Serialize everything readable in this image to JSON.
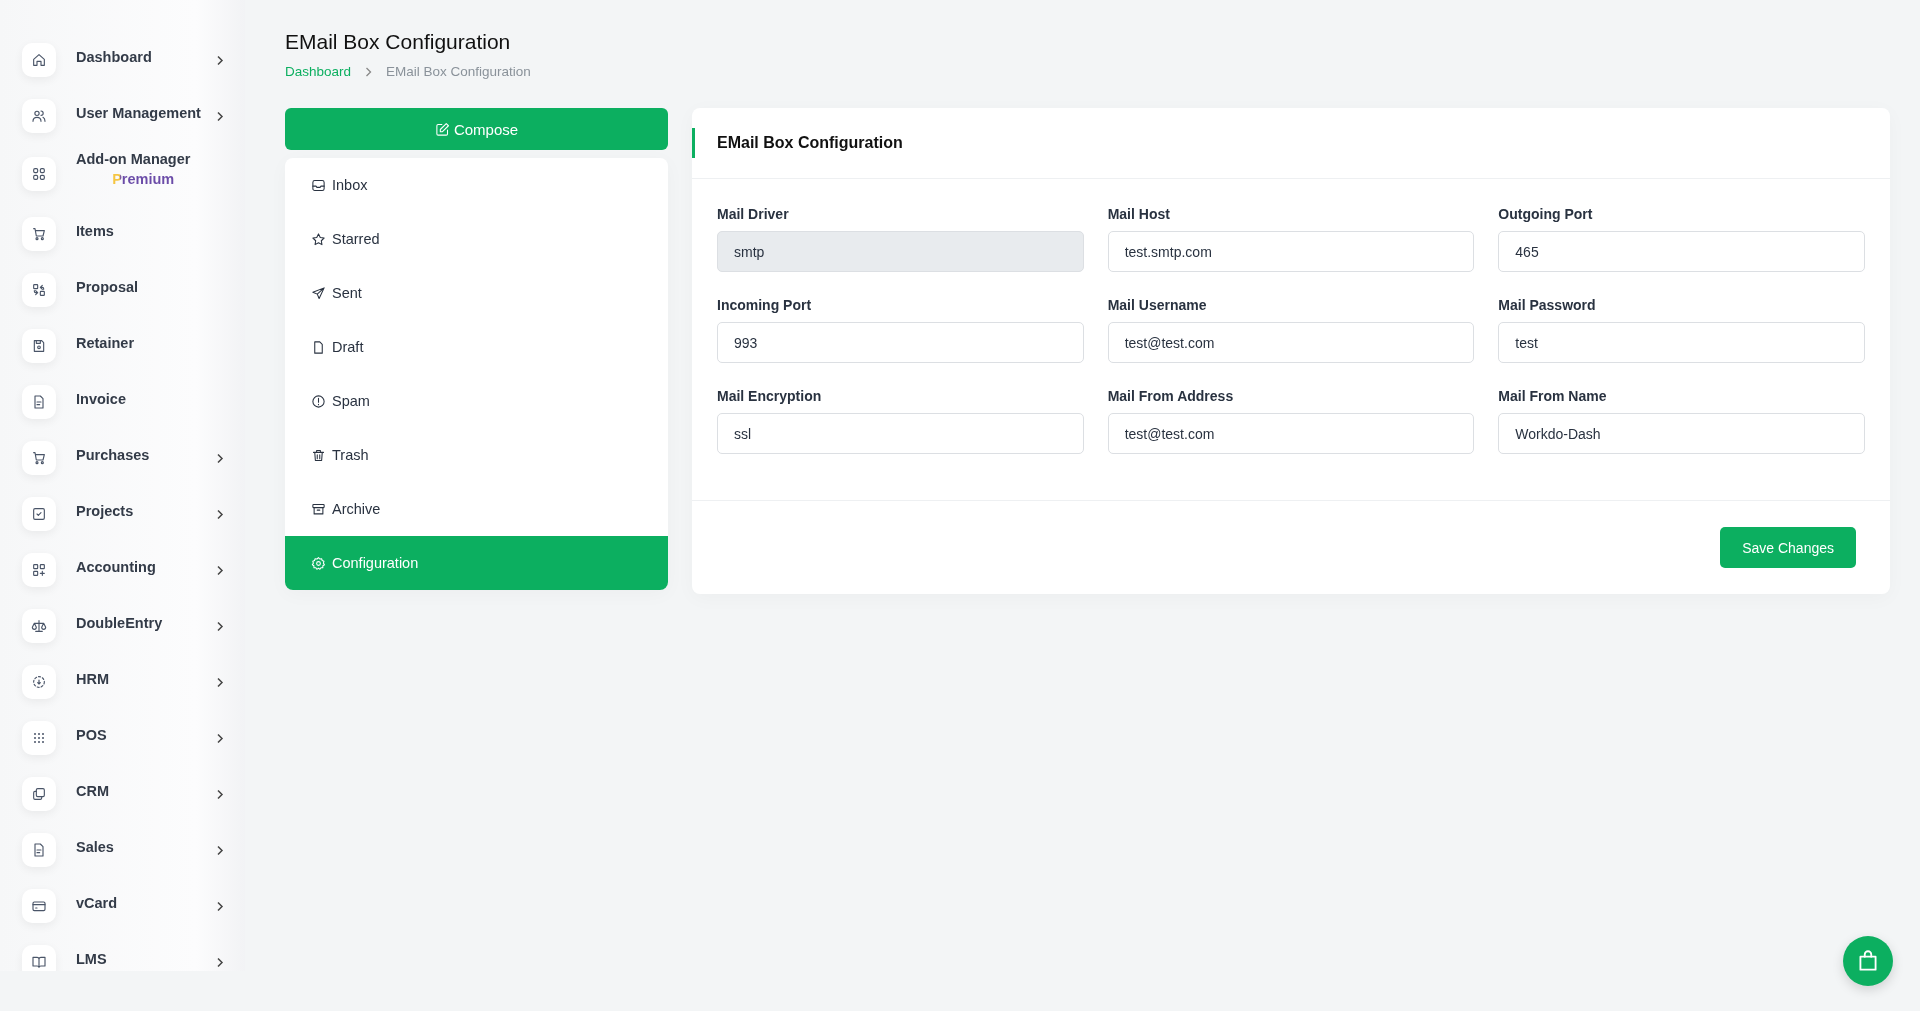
{
  "sidebar": {
    "items": [
      {
        "label": "Dashboard",
        "expandable": true
      },
      {
        "label": "User Management",
        "expandable": true
      },
      {
        "label": "Add-on Manager",
        "badge": "Premium",
        "expandable": false
      },
      {
        "label": "Items",
        "expandable": false
      },
      {
        "label": "Proposal",
        "expandable": false
      },
      {
        "label": "Retainer",
        "expandable": false
      },
      {
        "label": "Invoice",
        "expandable": false
      },
      {
        "label": "Purchases",
        "expandable": true
      },
      {
        "label": "Projects",
        "expandable": true
      },
      {
        "label": "Accounting",
        "expandable": true
      },
      {
        "label": "DoubleEntry",
        "expandable": true
      },
      {
        "label": "HRM",
        "expandable": true
      },
      {
        "label": "POS",
        "expandable": true
      },
      {
        "label": "CRM",
        "expandable": true
      },
      {
        "label": "Sales",
        "expandable": true
      },
      {
        "label": "vCard",
        "expandable": true
      },
      {
        "label": "LMS",
        "expandable": true
      }
    ]
  },
  "page": {
    "title": "EMail Box Configuration",
    "breadcrumb": [
      "Dashboard",
      "EMail Box Configuration"
    ]
  },
  "mail_menu": {
    "compose": "Compose",
    "items": [
      {
        "label": "Inbox",
        "selected": false
      },
      {
        "label": "Starred",
        "selected": false
      },
      {
        "label": "Sent",
        "selected": false
      },
      {
        "label": "Draft",
        "selected": false
      },
      {
        "label": "Spam",
        "selected": false
      },
      {
        "label": "Trash",
        "selected": false
      },
      {
        "label": "Archive",
        "selected": false
      },
      {
        "label": "Configuration",
        "selected": true
      }
    ]
  },
  "config": {
    "title": "EMail Box Configuration",
    "fields": [
      {
        "label": "Mail Driver",
        "value": "smtp",
        "disabled": true
      },
      {
        "label": "Mail Host",
        "value": "test.smtp.com",
        "disabled": false
      },
      {
        "label": "Outgoing Port",
        "value": "465",
        "disabled": false
      },
      {
        "label": "Incoming Port",
        "value": "993",
        "disabled": false
      },
      {
        "label": "Mail Username",
        "value": "test@test.com",
        "disabled": false
      },
      {
        "label": "Mail Password",
        "value": "test",
        "disabled": false
      },
      {
        "label": "Mail Encryption",
        "value": "ssl",
        "disabled": false
      },
      {
        "label": "Mail From Address",
        "value": "test@test.com",
        "disabled": false
      },
      {
        "label": "Mail From Name",
        "value": "Workdo-Dash",
        "disabled": false
      }
    ],
    "save": "Save Changes"
  }
}
